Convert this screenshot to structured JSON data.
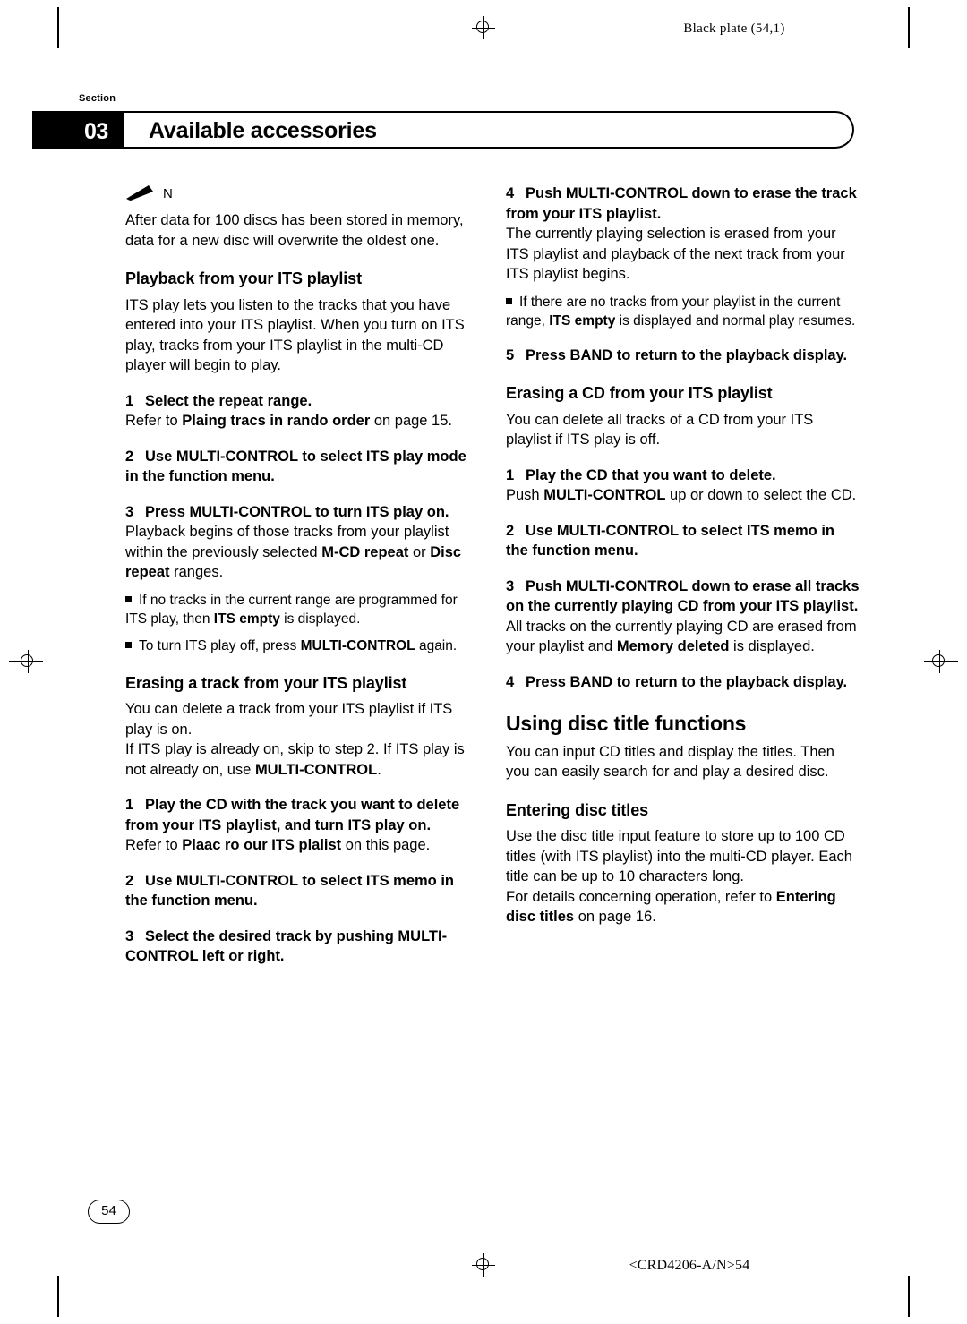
{
  "header": {
    "black_plate": "Black plate (54,1)",
    "section_word": "Section",
    "chapter_number": "03",
    "chapter_title": "Available accessories"
  },
  "footer": {
    "page_number": "54",
    "code": "<CRD4206-A/N>54"
  },
  "left_column": {
    "note_letter": "N",
    "note_text": "After data for 100 discs has been stored in memory, data for a new disc will overwrite the oldest one.",
    "h_playback": "Playback from your ITS playlist",
    "p_playback": "ITS play lets you listen to the tracks that you have entered into your ITS playlist. When you turn on ITS play, tracks from your ITS playlist in the multi-CD player will begin to play.",
    "step1_num": "1",
    "step1": "Select the repeat range.",
    "step1_body_pre": "Refer to ",
    "step1_body_bold": "Plaing tracs in rando order",
    "step1_body_post": " on page 15.",
    "step2_num": "2",
    "step2": "Use MULTI-CONTROL to select ITS play mode in the function menu.",
    "step3_num": "3",
    "step3": "Press MULTI-CONTROL to turn ITS play on.",
    "step3_body_pre": "Playback begins of those tracks from your playlist within the previously selected ",
    "step3_body_b1": "M-CD repeat",
    "step3_body_mid": " or ",
    "step3_body_b2": "Disc repeat",
    "step3_body_post": " ranges.",
    "bullet1_pre": "If no tracks in the current range are programmed for ITS play, then ",
    "bullet1_bold": "ITS empty",
    "bullet1_post": " is displayed.",
    "bullet2_pre": "To turn ITS play off, press ",
    "bullet2_bold": "MULTI-CONTROL",
    "bullet2_post": " again.",
    "h_erasing_track": "Erasing a track from your ITS playlist",
    "p_erasing_track": "You can delete a track from your ITS playlist if ITS play is on.",
    "p_erasing_track2_pre": "If ITS play is already on, skip to step 2. If ITS play is not already on, use ",
    "p_erasing_track2_bold": "MULTI-CONTROL",
    "p_erasing_track2_post": ".",
    "e_step1_num": "1",
    "e_step1": "Play the CD with the track you want to delete from your ITS playlist, and turn ITS play on.",
    "e_step1_body_pre": "Refer to ",
    "e_step1_body_bold": "Plaac ro our ITS plalist",
    "e_step1_body_post": " on this page.",
    "e_step2_num": "2",
    "e_step2": "Use MULTI-CONTROL to select ITS memo in the function menu.",
    "e_step3_num": "3",
    "e_step3": "Select the desired track by pushing MULTI-CONTROL left or right."
  },
  "right_column": {
    "r_step4_num": "4",
    "r_step4": "Push MULTI-CONTROL down to erase the track from your ITS playlist.",
    "r_step4_body": "The currently playing selection is erased from your ITS playlist and playback of the next track from your ITS playlist begins.",
    "r_bullet1_pre": "If there are no tracks from your playlist in the current range, ",
    "r_bullet1_bold": "ITS empty",
    "r_bullet1_post": " is displayed and normal play resumes.",
    "r_step5_num": "5",
    "r_step5": "Press BAND to return to the playback display.",
    "h_erasing_cd": "Erasing a CD from your ITS playlist",
    "p_erasing_cd": "You can delete all tracks of a CD from your ITS playlist if ITS play is off.",
    "c_step1_num": "1",
    "c_step1": "Play the CD that you want to delete.",
    "c_step1_body_pre": "Push ",
    "c_step1_body_bold": "MULTI-CONTROL",
    "c_step1_body_post": " up or down to select the CD.",
    "c_step2_num": "2",
    "c_step2": "Use MULTI-CONTROL to select ITS memo in the function menu.",
    "c_step3_num": "3",
    "c_step3": "Push MULTI-CONTROL down to erase all tracks on the currently playing CD from your ITS playlist.",
    "c_step3_body_pre": "All tracks on the currently playing CD are erased from your playlist and ",
    "c_step3_body_bold": "Memory deleted",
    "c_step3_body_post": " is displayed.",
    "c_step4_num": "4",
    "c_step4": "Press BAND to return to the playback display.",
    "h_using_disc": "Using disc title functions",
    "p_using_disc": "You can input CD titles and display the titles. Then you can easily search for and play a desired disc.",
    "h_entering": "Entering disc titles",
    "p_entering": "Use the disc title input feature to store up to 100 CD titles (with ITS playlist) into the multi-CD player. Each title can be up to 10 characters long.",
    "p_entering2_pre": "For details concerning operation, refer to ",
    "p_entering2_bold": "Entering disc titles",
    "p_entering2_post": " on page 16."
  }
}
